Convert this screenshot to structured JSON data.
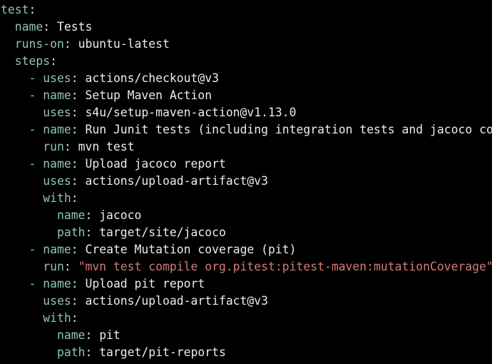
{
  "colors": {
    "background": "#000000",
    "key": "#8fc7a9",
    "value": "#ececec",
    "string": "#d07b7b"
  },
  "lines": [
    {
      "indent": "",
      "dash": "",
      "key": "test",
      "value": "",
      "vtype": "plain"
    },
    {
      "indent": "  ",
      "dash": "",
      "key": "name",
      "value": "Tests",
      "vtype": "plain"
    },
    {
      "indent": "  ",
      "dash": "",
      "key": "runs-on",
      "value": "ubuntu-latest",
      "vtype": "plain"
    },
    {
      "indent": "  ",
      "dash": "",
      "key": "steps",
      "value": "",
      "vtype": "plain"
    },
    {
      "indent": "    ",
      "dash": "- ",
      "key": "uses",
      "value": "actions/checkout@v3",
      "vtype": "plain"
    },
    {
      "indent": "    ",
      "dash": "- ",
      "key": "name",
      "value": "Setup Maven Action",
      "vtype": "plain"
    },
    {
      "indent": "      ",
      "dash": "",
      "key": "uses",
      "value": "s4u/setup-maven-action@v1.13.0",
      "vtype": "plain"
    },
    {
      "indent": "    ",
      "dash": "- ",
      "key": "name",
      "value": "Run Junit tests (including integration tests and jacoco coverage)",
      "vtype": "plain"
    },
    {
      "indent": "      ",
      "dash": "",
      "key": "run",
      "value": "mvn test",
      "vtype": "plain"
    },
    {
      "indent": "    ",
      "dash": "- ",
      "key": "name",
      "value": "Upload jacoco report",
      "vtype": "plain"
    },
    {
      "indent": "      ",
      "dash": "",
      "key": "uses",
      "value": "actions/upload-artifact@v3",
      "vtype": "plain"
    },
    {
      "indent": "      ",
      "dash": "",
      "key": "with",
      "value": "",
      "vtype": "plain"
    },
    {
      "indent": "        ",
      "dash": "",
      "key": "name",
      "value": "jacoco",
      "vtype": "plain"
    },
    {
      "indent": "        ",
      "dash": "",
      "key": "path",
      "value": "target/site/jacoco",
      "vtype": "plain"
    },
    {
      "indent": "    ",
      "dash": "- ",
      "key": "name",
      "value": "Create Mutation coverage (pit)",
      "vtype": "plain"
    },
    {
      "indent": "      ",
      "dash": "",
      "key": "run",
      "value": "\"mvn test compile org.pitest:pitest-maven:mutationCoverage\"",
      "vtype": "string"
    },
    {
      "indent": "    ",
      "dash": "- ",
      "key": "name",
      "value": "Upload pit report",
      "vtype": "plain"
    },
    {
      "indent": "      ",
      "dash": "",
      "key": "uses",
      "value": "actions/upload-artifact@v3",
      "vtype": "plain"
    },
    {
      "indent": "      ",
      "dash": "",
      "key": "with",
      "value": "",
      "vtype": "plain"
    },
    {
      "indent": "        ",
      "dash": "",
      "key": "name",
      "value": "pit",
      "vtype": "plain"
    },
    {
      "indent": "        ",
      "dash": "",
      "key": "path",
      "value": "target/pit-reports",
      "vtype": "plain"
    }
  ]
}
